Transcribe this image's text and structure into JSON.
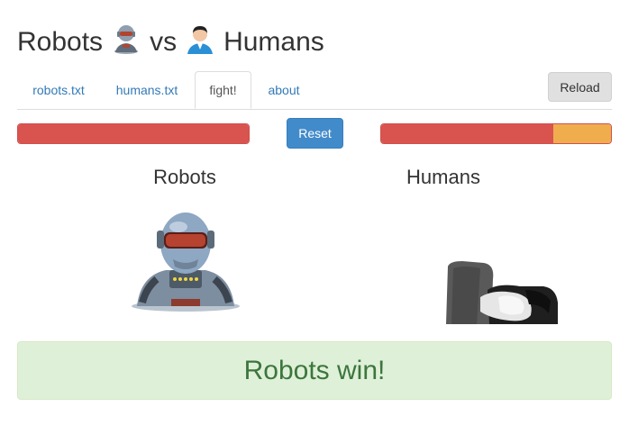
{
  "title": {
    "word1": "Robots",
    "vs": "vs",
    "word2": "Humans",
    "robot_icon": "robot-avatar-icon",
    "human_icon": "human-avatar-icon"
  },
  "tabs": [
    {
      "label": "robots.txt",
      "active": false
    },
    {
      "label": "humans.txt",
      "active": false
    },
    {
      "label": "fight!",
      "active": true
    },
    {
      "label": "about",
      "active": false
    }
  ],
  "buttons": {
    "reload": "Reload",
    "reset": "Reset"
  },
  "health": {
    "robots": {
      "red": 1.0,
      "orange": 0.0
    },
    "humans": {
      "red": 0.75,
      "orange": 0.25
    }
  },
  "fighters": {
    "left": "Robots",
    "right": "Humans"
  },
  "result": "Robots win!",
  "colors": {
    "link": "#337ab7",
    "danger": "#d9534f",
    "warning": "#f0ad4e",
    "primary": "#428bca",
    "success_bg": "#dff0d8",
    "success_text": "#3c763d"
  }
}
